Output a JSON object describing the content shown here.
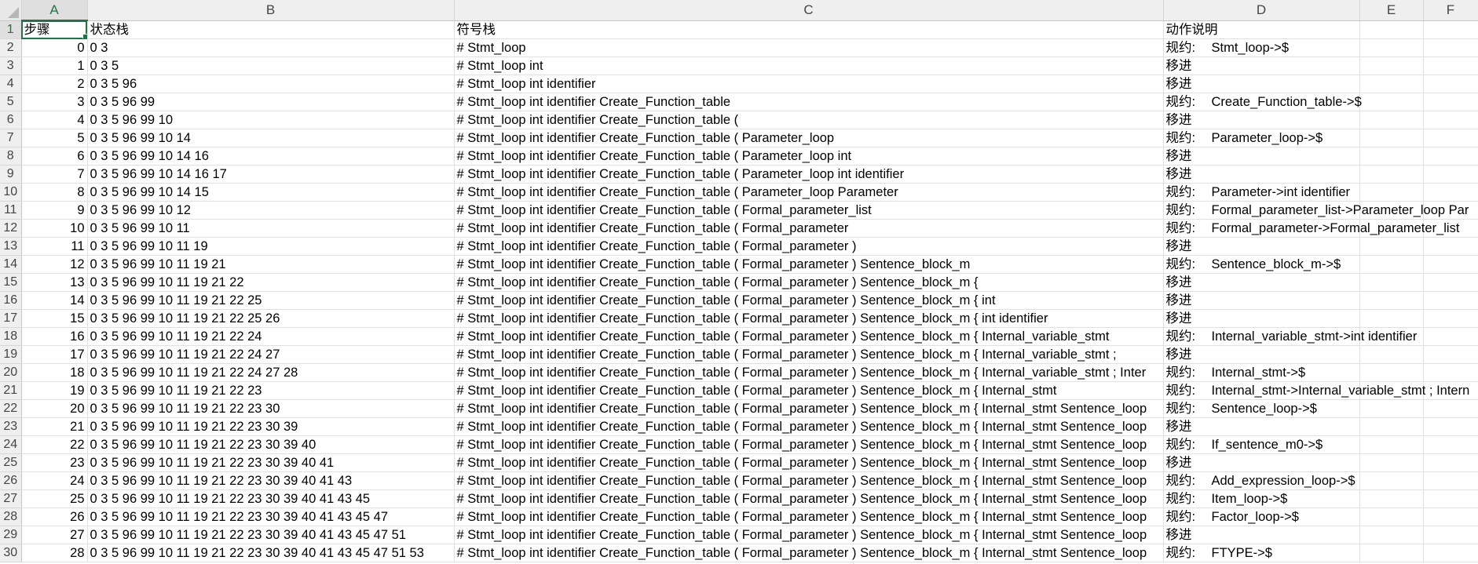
{
  "columns": [
    {
      "letter": "A",
      "width": 84
    },
    {
      "letter": "B",
      "width": 467
    },
    {
      "letter": "C",
      "width": 903
    },
    {
      "letter": "D",
      "width": 250
    },
    {
      "letter": "E",
      "width": 81
    },
    {
      "letter": "F",
      "width": 69
    }
  ],
  "header_row": {
    "num": "1",
    "a": "步骤",
    "b": "状态栈",
    "c": "符号栈",
    "d_label": "动作说明",
    "d_value": ""
  },
  "rows": [
    {
      "num": "2",
      "a": "0",
      "b": "0 3",
      "c": "# Stmt_loop",
      "d_label": "规约:",
      "d_value": "Stmt_loop->$"
    },
    {
      "num": "3",
      "a": "1",
      "b": "0 3 5",
      "c": "# Stmt_loop int",
      "d_label": "移进",
      "d_value": ""
    },
    {
      "num": "4",
      "a": "2",
      "b": "0 3 5 96",
      "c": "# Stmt_loop int identifier",
      "d_label": "移进",
      "d_value": ""
    },
    {
      "num": "5",
      "a": "3",
      "b": "0 3 5 96 99",
      "c": "# Stmt_loop int identifier Create_Function_table",
      "d_label": "规约:",
      "d_value": "Create_Function_table->$"
    },
    {
      "num": "6",
      "a": "4",
      "b": "0 3 5 96 99 10",
      "c": "# Stmt_loop int identifier Create_Function_table (",
      "d_label": "移进",
      "d_value": ""
    },
    {
      "num": "7",
      "a": "5",
      "b": "0 3 5 96 99 10 14",
      "c": "# Stmt_loop int identifier Create_Function_table ( Parameter_loop",
      "d_label": "规约:",
      "d_value": "Parameter_loop->$"
    },
    {
      "num": "8",
      "a": "6",
      "b": "0 3 5 96 99 10 14 16",
      "c": "# Stmt_loop int identifier Create_Function_table ( Parameter_loop int",
      "d_label": "移进",
      "d_value": ""
    },
    {
      "num": "9",
      "a": "7",
      "b": "0 3 5 96 99 10 14 16 17",
      "c": "# Stmt_loop int identifier Create_Function_table ( Parameter_loop int identifier",
      "d_label": "移进",
      "d_value": ""
    },
    {
      "num": "10",
      "a": "8",
      "b": "0 3 5 96 99 10 14 15",
      "c": "# Stmt_loop int identifier Create_Function_table ( Parameter_loop Parameter",
      "d_label": "规约:",
      "d_value": "Parameter->int identifier"
    },
    {
      "num": "11",
      "a": "9",
      "b": "0 3 5 96 99 10 12",
      "c": "# Stmt_loop int identifier Create_Function_table ( Formal_parameter_list",
      "d_label": "规约:",
      "d_value": "Formal_parameter_list->Parameter_loop Par"
    },
    {
      "num": "12",
      "a": "10",
      "b": "0 3 5 96 99 10 11",
      "c": "# Stmt_loop int identifier Create_Function_table ( Formal_parameter",
      "d_label": "规约:",
      "d_value": "Formal_parameter->Formal_parameter_list"
    },
    {
      "num": "13",
      "a": "11",
      "b": "0 3 5 96 99 10 11 19",
      "c": "# Stmt_loop int identifier Create_Function_table ( Formal_parameter )",
      "d_label": "移进",
      "d_value": ""
    },
    {
      "num": "14",
      "a": "12",
      "b": "0 3 5 96 99 10 11 19 21",
      "c": "# Stmt_loop int identifier Create_Function_table ( Formal_parameter ) Sentence_block_m",
      "d_label": "规约:",
      "d_value": "Sentence_block_m->$"
    },
    {
      "num": "15",
      "a": "13",
      "b": "0 3 5 96 99 10 11 19 21 22",
      "c": "# Stmt_loop int identifier Create_Function_table ( Formal_parameter ) Sentence_block_m {",
      "d_label": "移进",
      "d_value": ""
    },
    {
      "num": "16",
      "a": "14",
      "b": "0 3 5 96 99 10 11 19 21 22 25",
      "c": "# Stmt_loop int identifier Create_Function_table ( Formal_parameter ) Sentence_block_m { int",
      "d_label": "移进",
      "d_value": ""
    },
    {
      "num": "17",
      "a": "15",
      "b": "0 3 5 96 99 10 11 19 21 22 25 26",
      "c": "# Stmt_loop int identifier Create_Function_table ( Formal_parameter ) Sentence_block_m { int identifier",
      "d_label": "移进",
      "d_value": ""
    },
    {
      "num": "18",
      "a": "16",
      "b": "0 3 5 96 99 10 11 19 21 22 24",
      "c": "# Stmt_loop int identifier Create_Function_table ( Formal_parameter ) Sentence_block_m { Internal_variable_stmt",
      "d_label": "规约:",
      "d_value": "Internal_variable_stmt->int identifier"
    },
    {
      "num": "19",
      "a": "17",
      "b": "0 3 5 96 99 10 11 19 21 22 24 27",
      "c": "# Stmt_loop int identifier Create_Function_table ( Formal_parameter ) Sentence_block_m { Internal_variable_stmt ;",
      "d_label": "移进",
      "d_value": ""
    },
    {
      "num": "20",
      "a": "18",
      "b": "0 3 5 96 99 10 11 19 21 22 24 27 28",
      "c": "# Stmt_loop int identifier Create_Function_table ( Formal_parameter ) Sentence_block_m { Internal_variable_stmt ; Inter",
      "d_label": "规约:",
      "d_value": "Internal_stmt->$"
    },
    {
      "num": "21",
      "a": "19",
      "b": "0 3 5 96 99 10 11 19 21 22 23",
      "c": "# Stmt_loop int identifier Create_Function_table ( Formal_parameter ) Sentence_block_m { Internal_stmt",
      "d_label": "规约:",
      "d_value": "Internal_stmt->Internal_variable_stmt ; Intern"
    },
    {
      "num": "22",
      "a": "20",
      "b": "0 3 5 96 99 10 11 19 21 22 23 30",
      "c": "# Stmt_loop int identifier Create_Function_table ( Formal_parameter ) Sentence_block_m { Internal_stmt Sentence_loop",
      "d_label": "规约:",
      "d_value": "Sentence_loop->$"
    },
    {
      "num": "23",
      "a": "21",
      "b": "0 3 5 96 99 10 11 19 21 22 23 30 39",
      "c": "# Stmt_loop int identifier Create_Function_table ( Formal_parameter ) Sentence_block_m { Internal_stmt Sentence_loop",
      "d_label": "移进",
      "d_value": ""
    },
    {
      "num": "24",
      "a": "22",
      "b": "0 3 5 96 99 10 11 19 21 22 23 30 39 40",
      "c": "# Stmt_loop int identifier Create_Function_table ( Formal_parameter ) Sentence_block_m { Internal_stmt Sentence_loop",
      "d_label": "规约:",
      "d_value": "If_sentence_m0->$"
    },
    {
      "num": "25",
      "a": "23",
      "b": "0 3 5 96 99 10 11 19 21 22 23 30 39 40 41",
      "c": "# Stmt_loop int identifier Create_Function_table ( Formal_parameter ) Sentence_block_m { Internal_stmt Sentence_loop",
      "d_label": "移进",
      "d_value": ""
    },
    {
      "num": "26",
      "a": "24",
      "b": "0 3 5 96 99 10 11 19 21 22 23 30 39 40 41 43",
      "c": "# Stmt_loop int identifier Create_Function_table ( Formal_parameter ) Sentence_block_m { Internal_stmt Sentence_loop",
      "d_label": "规约:",
      "d_value": "Add_expression_loop->$"
    },
    {
      "num": "27",
      "a": "25",
      "b": "0 3 5 96 99 10 11 19 21 22 23 30 39 40 41 43 45",
      "c": "# Stmt_loop int identifier Create_Function_table ( Formal_parameter ) Sentence_block_m { Internal_stmt Sentence_loop",
      "d_label": "规约:",
      "d_value": "Item_loop->$"
    },
    {
      "num": "28",
      "a": "26",
      "b": "0 3 5 96 99 10 11 19 21 22 23 30 39 40 41 43 45 47",
      "c": "# Stmt_loop int identifier Create_Function_table ( Formal_parameter ) Sentence_block_m { Internal_stmt Sentence_loop",
      "d_label": "规约:",
      "d_value": "Factor_loop->$"
    },
    {
      "num": "29",
      "a": "27",
      "b": "0 3 5 96 99 10 11 19 21 22 23 30 39 40 41 43 45 47 51",
      "c": "# Stmt_loop int identifier Create_Function_table ( Formal_parameter ) Sentence_block_m { Internal_stmt Sentence_loop",
      "d_label": "移进",
      "d_value": ""
    },
    {
      "num": "30",
      "a": "28",
      "b": "0 3 5 96 99 10 11 19 21 22 23 30 39 40 41 43 45 47 51 53",
      "c": "# Stmt_loop int identifier Create_Function_table ( Formal_parameter ) Sentence_block_m { Internal_stmt Sentence_loop",
      "d_label": "规约:",
      "d_value": "FTYPE->$"
    }
  ],
  "colors": {
    "accent": "#217346",
    "header_bg": "#efefef",
    "grid_line": "#e1e1e1"
  }
}
